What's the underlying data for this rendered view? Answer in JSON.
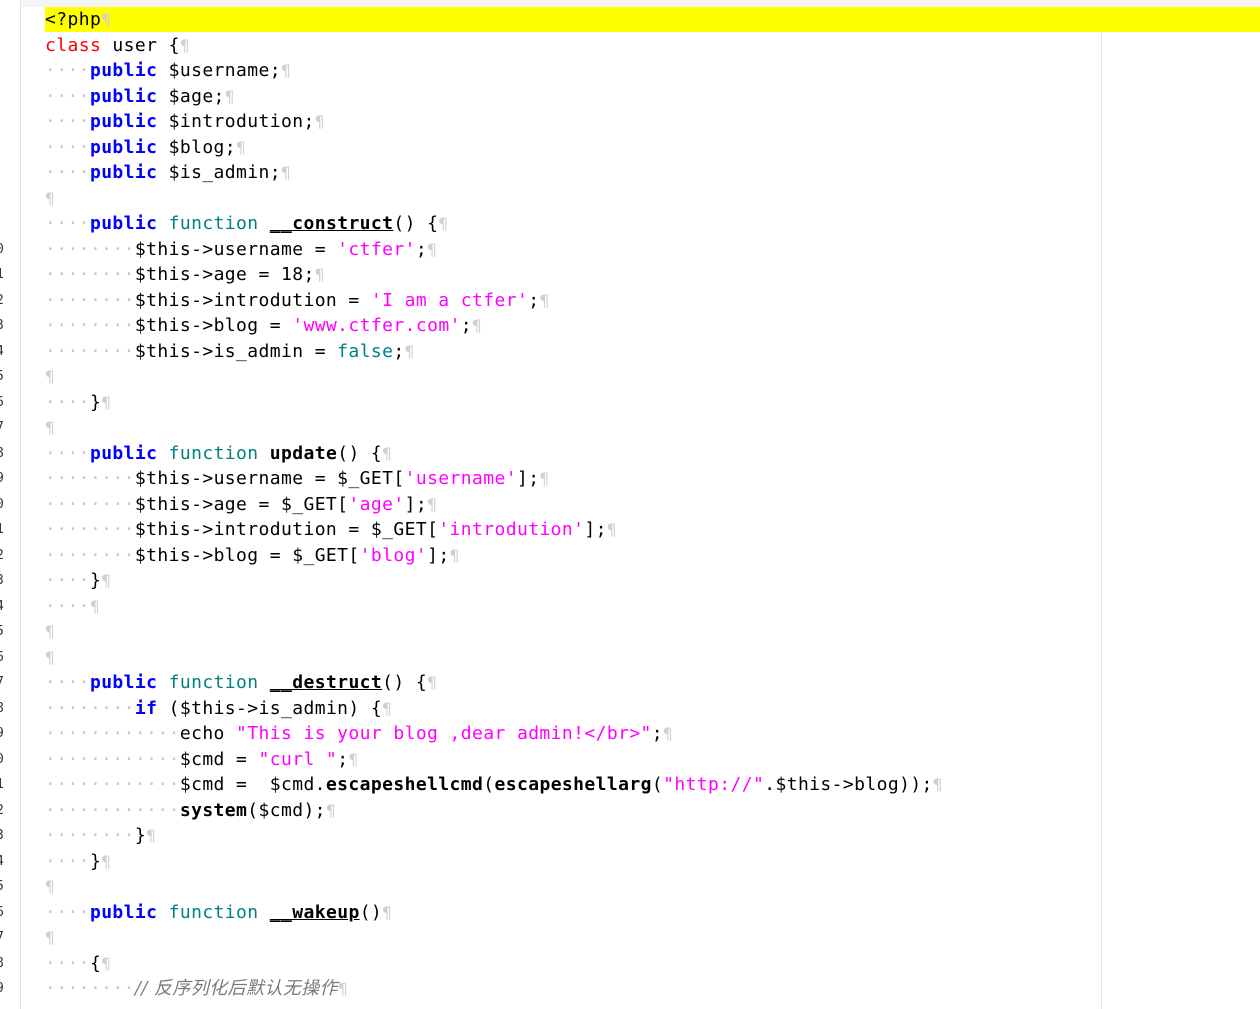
{
  "editor": {
    "line_numbers": [
      "0",
      "1",
      "2",
      "3",
      "4",
      "5",
      "6",
      "7",
      "8",
      "9",
      "0",
      "1",
      "2",
      "3",
      "4",
      "5",
      "6",
      "7",
      "8",
      "9",
      "0",
      "1",
      "2",
      "3",
      "4",
      "5",
      "6",
      "7",
      "8",
      "9"
    ],
    "lines": [
      {
        "tokens": [
          {
            "t": "<?php",
            "c": "plain"
          }
        ]
      },
      {
        "tokens": [
          {
            "t": "class",
            "c": "kw-red"
          },
          {
            "t": " user ",
            "c": "plain"
          },
          {
            "t": "{",
            "c": "plain"
          }
        ]
      },
      {
        "tokens": [
          {
            "t": "····",
            "c": "ws"
          },
          {
            "t": "public",
            "c": "kw-blue"
          },
          {
            "t": " $username;",
            "c": "plain"
          }
        ]
      },
      {
        "tokens": [
          {
            "t": "····",
            "c": "ws"
          },
          {
            "t": "public",
            "c": "kw-blue"
          },
          {
            "t": " $age;",
            "c": "plain"
          }
        ]
      },
      {
        "tokens": [
          {
            "t": "····",
            "c": "ws"
          },
          {
            "t": "public",
            "c": "kw-blue"
          },
          {
            "t": " $introdution;",
            "c": "plain"
          }
        ]
      },
      {
        "tokens": [
          {
            "t": "····",
            "c": "ws"
          },
          {
            "t": "public",
            "c": "kw-blue"
          },
          {
            "t": " $blog;",
            "c": "plain"
          }
        ]
      },
      {
        "tokens": [
          {
            "t": "····",
            "c": "ws"
          },
          {
            "t": "public",
            "c": "kw-blue"
          },
          {
            "t": " $is_admin;",
            "c": "plain"
          }
        ]
      },
      {
        "tokens": []
      },
      {
        "tokens": [
          {
            "t": "····",
            "c": "ws"
          },
          {
            "t": "public",
            "c": "kw-blue"
          },
          {
            "t": " ",
            "c": "plain"
          },
          {
            "t": "function",
            "c": "kw-teal"
          },
          {
            "t": " ",
            "c": "plain"
          },
          {
            "t": "__construct",
            "c": "bold"
          },
          {
            "t": "() {",
            "c": "plain"
          }
        ]
      },
      {
        "tokens": [
          {
            "t": "········",
            "c": "ws"
          },
          {
            "t": "$this->username = ",
            "c": "plain"
          },
          {
            "t": "'ctfer'",
            "c": "str"
          },
          {
            "t": ";",
            "c": "plain"
          }
        ]
      },
      {
        "tokens": [
          {
            "t": "········",
            "c": "ws"
          },
          {
            "t": "$this->age = ",
            "c": "plain"
          },
          {
            "t": "18",
            "c": "plain"
          },
          {
            "t": ";",
            "c": "plain"
          }
        ]
      },
      {
        "tokens": [
          {
            "t": "········",
            "c": "ws"
          },
          {
            "t": "$this->introdution = ",
            "c": "plain"
          },
          {
            "t": "'I am a ctfer'",
            "c": "str"
          },
          {
            "t": ";",
            "c": "plain"
          }
        ]
      },
      {
        "tokens": [
          {
            "t": "········",
            "c": "ws"
          },
          {
            "t": "$this->blog = ",
            "c": "plain"
          },
          {
            "t": "'www.ctfer.com'",
            "c": "str"
          },
          {
            "t": ";",
            "c": "plain"
          }
        ]
      },
      {
        "tokens": [
          {
            "t": "········",
            "c": "ws"
          },
          {
            "t": "$this->is_admin = ",
            "c": "plain"
          },
          {
            "t": "false",
            "c": "kw-teal"
          },
          {
            "t": ";",
            "c": "plain"
          }
        ]
      },
      {
        "tokens": []
      },
      {
        "tokens": [
          {
            "t": "····",
            "c": "ws"
          },
          {
            "t": "}",
            "c": "plain"
          }
        ]
      },
      {
        "tokens": []
      },
      {
        "tokens": [
          {
            "t": "····",
            "c": "ws"
          },
          {
            "t": "public",
            "c": "kw-blue"
          },
          {
            "t": " ",
            "c": "plain"
          },
          {
            "t": "function",
            "c": "kw-teal"
          },
          {
            "t": " ",
            "c": "plain"
          },
          {
            "t": "update",
            "c": "bold"
          },
          {
            "t": "() {",
            "c": "plain"
          }
        ]
      },
      {
        "tokens": [
          {
            "t": "········",
            "c": "ws"
          },
          {
            "t": "$this->username = $_GET[",
            "c": "plain"
          },
          {
            "t": "'username'",
            "c": "str"
          },
          {
            "t": "];",
            "c": "plain"
          }
        ]
      },
      {
        "tokens": [
          {
            "t": "········",
            "c": "ws"
          },
          {
            "t": "$this->age = $_GET[",
            "c": "plain"
          },
          {
            "t": "'age'",
            "c": "str"
          },
          {
            "t": "];",
            "c": "plain"
          }
        ]
      },
      {
        "tokens": [
          {
            "t": "········",
            "c": "ws"
          },
          {
            "t": "$this->introdution = $_GET[",
            "c": "plain"
          },
          {
            "t": "'introdution'",
            "c": "str"
          },
          {
            "t": "];",
            "c": "plain"
          }
        ]
      },
      {
        "tokens": [
          {
            "t": "········",
            "c": "ws"
          },
          {
            "t": "$this->blog = $_GET[",
            "c": "plain"
          },
          {
            "t": "'blog'",
            "c": "str"
          },
          {
            "t": "];",
            "c": "plain"
          }
        ]
      },
      {
        "tokens": [
          {
            "t": "····",
            "c": "ws"
          },
          {
            "t": "}",
            "c": "plain"
          }
        ]
      },
      {
        "tokens": [
          {
            "t": "····",
            "c": "ws"
          }
        ]
      },
      {
        "tokens": []
      },
      {
        "tokens": []
      },
      {
        "tokens": [
          {
            "t": "····",
            "c": "ws"
          },
          {
            "t": "public",
            "c": "kw-blue"
          },
          {
            "t": " ",
            "c": "plain"
          },
          {
            "t": "function",
            "c": "kw-teal"
          },
          {
            "t": " ",
            "c": "plain"
          },
          {
            "t": "__destruct",
            "c": "bold"
          },
          {
            "t": "() {",
            "c": "plain"
          }
        ]
      },
      {
        "tokens": [
          {
            "t": "········",
            "c": "ws"
          },
          {
            "t": "if",
            "c": "kw-blue"
          },
          {
            "t": " ($this->is_admin) {",
            "c": "plain"
          }
        ]
      },
      {
        "tokens": [
          {
            "t": "············",
            "c": "ws"
          },
          {
            "t": "echo ",
            "c": "plain"
          },
          {
            "t": "\"This is your blog ,dear admin!</br>\"",
            "c": "str"
          },
          {
            "t": ";",
            "c": "plain"
          }
        ]
      },
      {
        "tokens": [
          {
            "t": "············",
            "c": "ws"
          },
          {
            "t": "$cmd = ",
            "c": "plain"
          },
          {
            "t": "\"curl \"",
            "c": "str"
          },
          {
            "t": ";",
            "c": "plain"
          }
        ]
      },
      {
        "tokens": [
          {
            "t": "············",
            "c": "ws"
          },
          {
            "t": "$cmd =  $cmd.",
            "c": "plain"
          },
          {
            "t": "escapeshellcmd",
            "c": "bold"
          },
          {
            "t": "(",
            "c": "plain"
          },
          {
            "t": "escapeshellarg",
            "c": "bold"
          },
          {
            "t": "(",
            "c": "plain"
          },
          {
            "t": "\"http://\"",
            "c": "str"
          },
          {
            "t": ".$this->blog));",
            "c": "plain"
          }
        ]
      },
      {
        "tokens": [
          {
            "t": "············",
            "c": "ws"
          },
          {
            "t": "system",
            "c": "bold"
          },
          {
            "t": "($cmd);",
            "c": "plain"
          }
        ]
      },
      {
        "tokens": [
          {
            "t": "········",
            "c": "ws"
          },
          {
            "t": "}",
            "c": "plain"
          }
        ]
      },
      {
        "tokens": [
          {
            "t": "····",
            "c": "ws"
          },
          {
            "t": "}",
            "c": "plain"
          }
        ]
      },
      {
        "tokens": []
      },
      {
        "tokens": [
          {
            "t": "····",
            "c": "ws"
          },
          {
            "t": "public",
            "c": "kw-blue"
          },
          {
            "t": " ",
            "c": "plain"
          },
          {
            "t": "function",
            "c": "kw-teal"
          },
          {
            "t": " ",
            "c": "plain"
          },
          {
            "t": "__wakeup",
            "c": "bold"
          },
          {
            "t": "()",
            "c": "plain"
          }
        ]
      },
      {
        "tokens": []
      },
      {
        "tokens": [
          {
            "t": "····",
            "c": "ws"
          },
          {
            "t": "{",
            "c": "plain"
          }
        ]
      },
      {
        "tokens": [
          {
            "t": "········",
            "c": "ws"
          },
          {
            "t": "// 反序列化后默认无操作",
            "c": "cmt"
          }
        ]
      }
    ],
    "pilcrow": "¶",
    "highlight_color": "#ffff00"
  }
}
